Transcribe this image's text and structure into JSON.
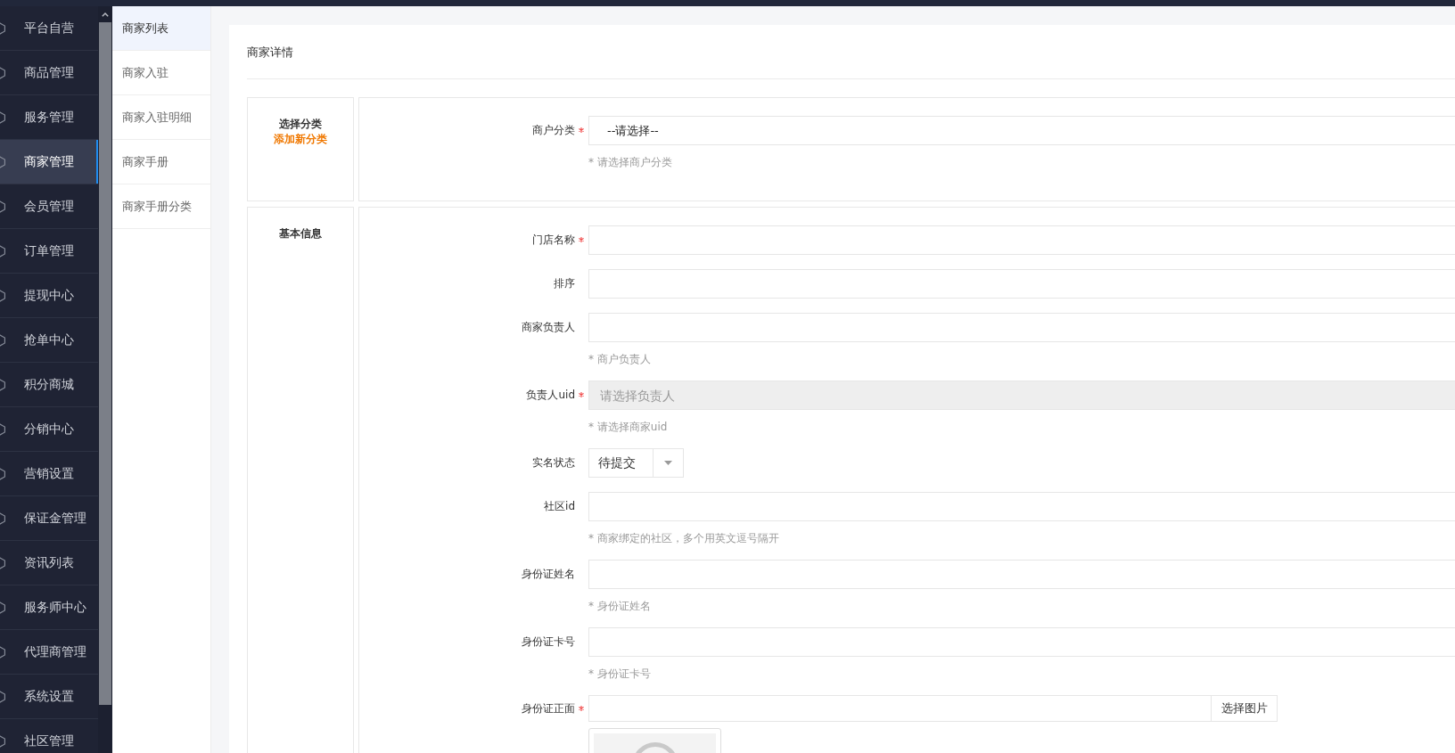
{
  "sidebar": {
    "items": [
      {
        "label": "平台自营",
        "selected": false
      },
      {
        "label": "商品管理",
        "selected": false
      },
      {
        "label": "服务管理",
        "selected": false
      },
      {
        "label": "商家管理",
        "selected": true
      },
      {
        "label": "会员管理",
        "selected": false
      },
      {
        "label": "订单管理",
        "selected": false
      },
      {
        "label": "提现中心",
        "selected": false
      },
      {
        "label": "抢单中心",
        "selected": false
      },
      {
        "label": "积分商城",
        "selected": false
      },
      {
        "label": "分销中心",
        "selected": false
      },
      {
        "label": "营销设置",
        "selected": false
      },
      {
        "label": "保证金管理",
        "selected": false
      },
      {
        "label": "资讯列表",
        "selected": false
      },
      {
        "label": "服务师中心",
        "selected": false
      },
      {
        "label": "代理商管理",
        "selected": false
      },
      {
        "label": "系统设置",
        "selected": false
      },
      {
        "label": "社区管理",
        "selected": false
      }
    ]
  },
  "submenu": {
    "items": [
      {
        "label": "商家列表",
        "selected": true
      },
      {
        "label": "商家入驻",
        "selected": false
      },
      {
        "label": "商家入驻明细",
        "selected": false
      },
      {
        "label": "商家手册",
        "selected": false
      },
      {
        "label": "商家手册分类",
        "selected": false
      }
    ]
  },
  "page": {
    "title": "商家详情"
  },
  "sections": [
    {
      "title": "选择分类",
      "link": "添加新分类",
      "fields": [
        {
          "kind": "select",
          "label": "商户分类",
          "required": true,
          "disabled": false,
          "value": "--请选择--",
          "hint": "* 请选择商户分类"
        }
      ]
    },
    {
      "title": "基本信息",
      "fields": [
        {
          "kind": "text",
          "label": "门店名称",
          "required": true,
          "disabled": false
        },
        {
          "kind": "text",
          "label": "排序",
          "required": false,
          "disabled": false
        },
        {
          "kind": "text",
          "label": "商家负责人",
          "required": false,
          "disabled": false,
          "hint": "* 商户负责人"
        },
        {
          "kind": "text",
          "label": "负责人uid",
          "required": true,
          "disabled": true,
          "placeholder": "请选择负责人",
          "hint": "* 请选择商家uid"
        },
        {
          "kind": "dropdown",
          "label": "实名状态",
          "required": false,
          "disabled": false,
          "value": "待提交"
        },
        {
          "kind": "text",
          "label": "社区id",
          "required": false,
          "disabled": false,
          "hint": "* 商家绑定的社区，多个用英文逗号隔开"
        },
        {
          "kind": "text",
          "label": "身份证姓名",
          "required": false,
          "disabled": false,
          "hint": "* 身份证姓名"
        },
        {
          "kind": "text",
          "label": "身份证卡号",
          "required": false,
          "disabled": false,
          "hint": "* 身份证卡号"
        },
        {
          "kind": "file",
          "label": "身份证正面",
          "required": true,
          "disabled": false,
          "button": "选择图片"
        }
      ]
    }
  ]
}
